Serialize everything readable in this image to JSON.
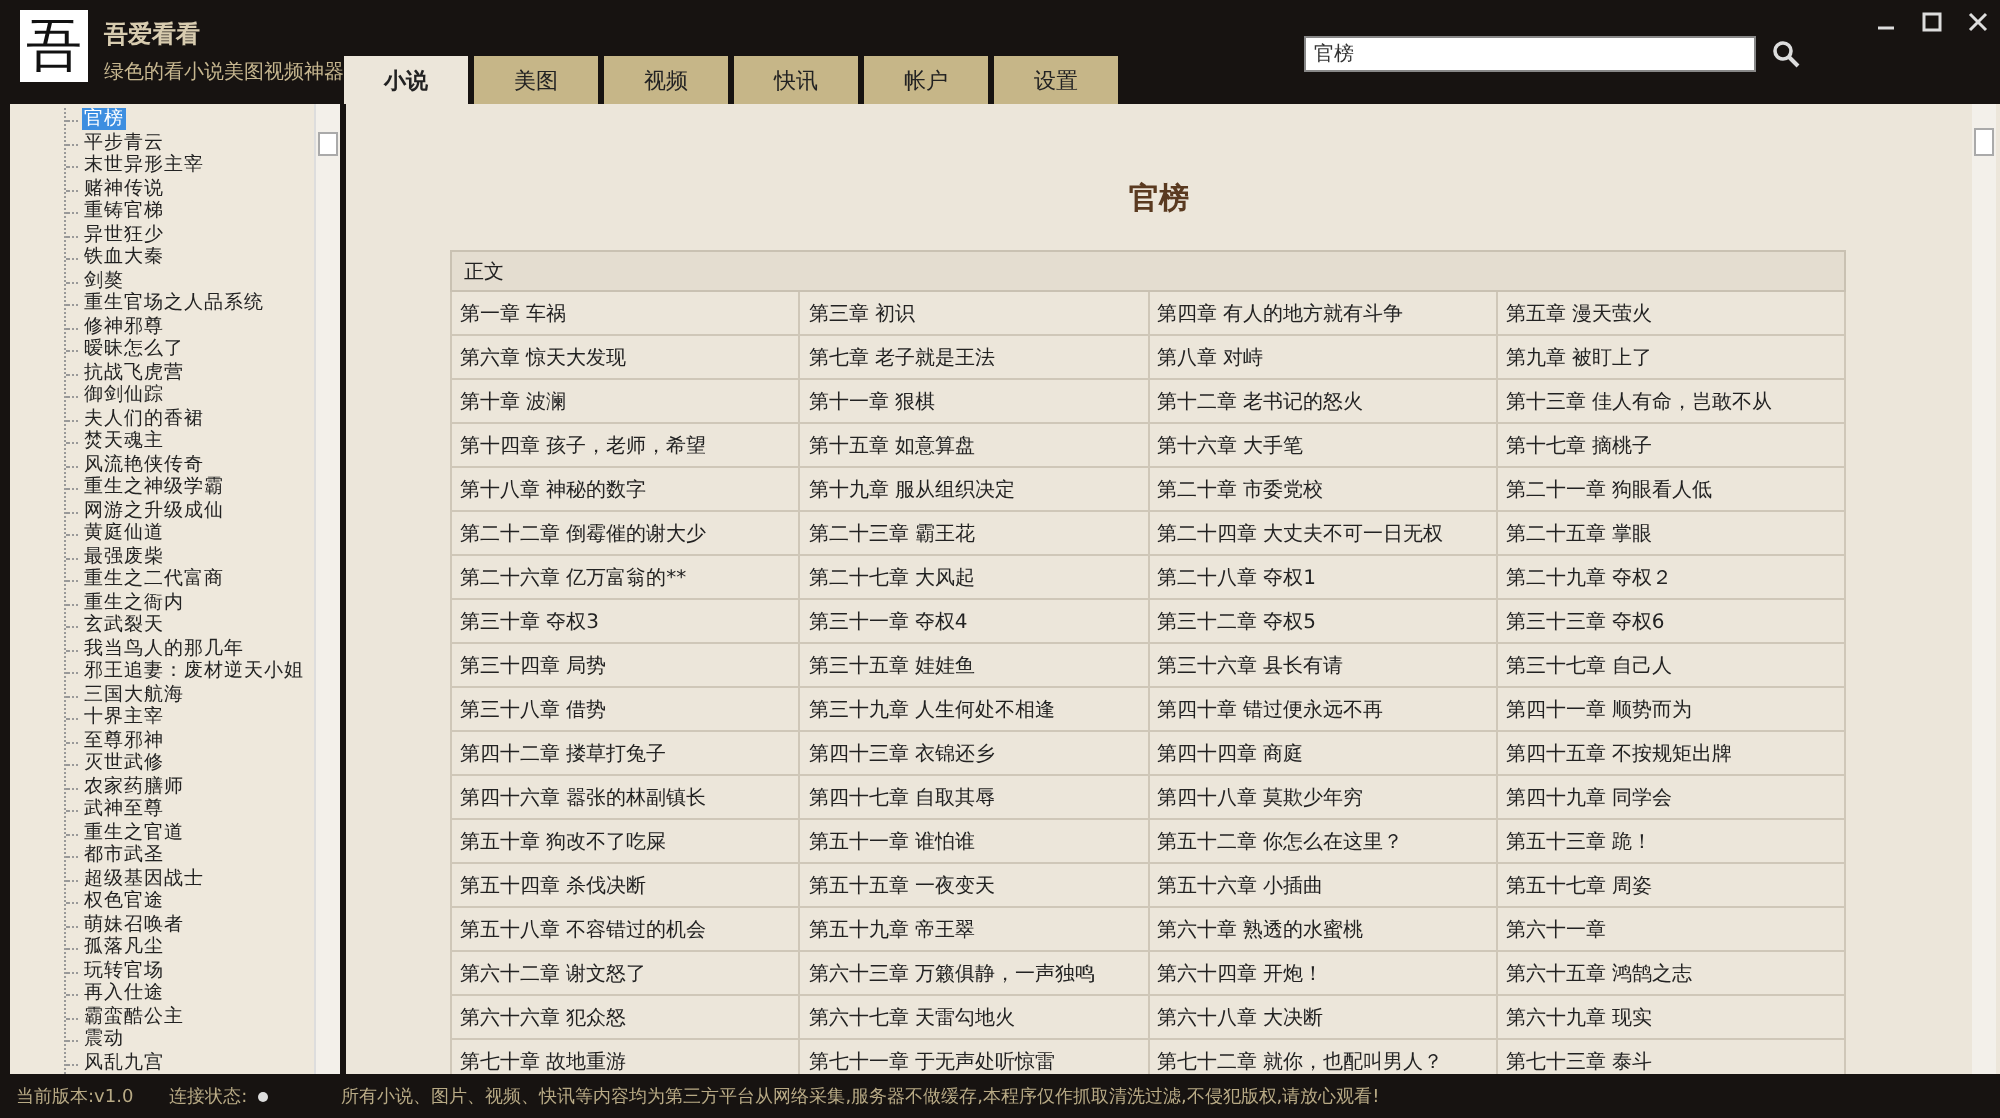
{
  "app": {
    "logo": "吾",
    "name": "吾爱看看",
    "tagline": "绿色的看小说美图视频神器"
  },
  "tabs": [
    {
      "label": "小说",
      "selected": true
    },
    {
      "label": "美图",
      "selected": false
    },
    {
      "label": "视频",
      "selected": false
    },
    {
      "label": "快讯",
      "selected": false
    },
    {
      "label": "帐户",
      "selected": false
    },
    {
      "label": "设置",
      "selected": false
    }
  ],
  "search": {
    "value": "官榜"
  },
  "sidebar": {
    "items": [
      {
        "label": "官榜",
        "selected": true
      },
      {
        "label": "平步青云",
        "selected": false
      },
      {
        "label": "末世异形主宰",
        "selected": false
      },
      {
        "label": "赌神传说",
        "selected": false
      },
      {
        "label": "重铸官梯",
        "selected": false
      },
      {
        "label": "异世狂少",
        "selected": false
      },
      {
        "label": "铁血大秦",
        "selected": false
      },
      {
        "label": "剑獒",
        "selected": false
      },
      {
        "label": "重生官场之人品系统",
        "selected": false
      },
      {
        "label": "修神邪尊",
        "selected": false
      },
      {
        "label": "暧昧怎么了",
        "selected": false
      },
      {
        "label": "抗战飞虎营",
        "selected": false
      },
      {
        "label": "御剑仙踪",
        "selected": false
      },
      {
        "label": "夫人们的香裙",
        "selected": false
      },
      {
        "label": "焚天魂主",
        "selected": false
      },
      {
        "label": "风流艳侠传奇",
        "selected": false
      },
      {
        "label": "重生之神级学霸",
        "selected": false
      },
      {
        "label": "网游之升级成仙",
        "selected": false
      },
      {
        "label": "黄庭仙道",
        "selected": false
      },
      {
        "label": "最强废柴",
        "selected": false
      },
      {
        "label": "重生之二代富商",
        "selected": false
      },
      {
        "label": "重生之衙内",
        "selected": false
      },
      {
        "label": "玄武裂天",
        "selected": false
      },
      {
        "label": "我当鸟人的那几年",
        "selected": false
      },
      {
        "label": "邪王追妻：废材逆天小姐",
        "selected": false
      },
      {
        "label": "三国大航海",
        "selected": false
      },
      {
        "label": "十界主宰",
        "selected": false
      },
      {
        "label": "至尊邪神",
        "selected": false
      },
      {
        "label": "灭世武修",
        "selected": false
      },
      {
        "label": "农家药膳师",
        "selected": false
      },
      {
        "label": "武神至尊",
        "selected": false
      },
      {
        "label": "重生之官道",
        "selected": false
      },
      {
        "label": "都市武圣",
        "selected": false
      },
      {
        "label": "超级基因战士",
        "selected": false
      },
      {
        "label": "权色官途",
        "selected": false
      },
      {
        "label": "萌妹召唤者",
        "selected": false
      },
      {
        "label": "孤落凡尘",
        "selected": false
      },
      {
        "label": "玩转官场",
        "selected": false
      },
      {
        "label": "再入仕途",
        "selected": false
      },
      {
        "label": "霸蛮酷公主",
        "selected": false
      },
      {
        "label": "震动",
        "selected": false
      },
      {
        "label": "风乱九宫",
        "selected": false
      }
    ]
  },
  "content": {
    "title": "官榜",
    "table": {
      "header": "正文",
      "rows": [
        [
          "第一章 车祸",
          "第三章 初识",
          "第四章 有人的地方就有斗争",
          "第五章 漫天萤火"
        ],
        [
          "第六章 惊天大发现",
          "第七章 老子就是王法",
          "第八章 对峙",
          "第九章 被盯上了"
        ],
        [
          "第十章 波澜",
          "第十一章 狠棋",
          "第十二章 老书记的怒火",
          "第十三章 佳人有命，岂敢不从"
        ],
        [
          "第十四章 孩子，老师，希望",
          "第十五章 如意算盘",
          "第十六章 大手笔",
          "第十七章 摘桃子"
        ],
        [
          "第十八章 神秘的数字",
          "第十九章 服从组织决定",
          "第二十章 市委党校",
          "第二十一章 狗眼看人低"
        ],
        [
          "第二十二章 倒霉催的谢大少",
          "第二十三章 霸王花",
          "第二十四章 大丈夫不可一日无权",
          "第二十五章 掌眼"
        ],
        [
          "第二十六章 亿万富翁的**",
          "第二十七章 大风起",
          "第二十八章 夺权1",
          "第二十九章 夺权２"
        ],
        [
          "第三十章 夺权3",
          "第三十一章 夺权4",
          "第三十二章 夺权5",
          "第三十三章 夺权6"
        ],
        [
          "第三十四章 局势",
          "第三十五章 娃娃鱼",
          "第三十六章 县长有请",
          "第三十七章 自己人"
        ],
        [
          "第三十八章 借势",
          "第三十九章 人生何处不相逢",
          "第四十章 错过便永远不再",
          "第四十一章 顺势而为"
        ],
        [
          "第四十二章 搂草打兔子",
          "第四十三章 衣锦还乡",
          "第四十四章 商庭",
          "第四十五章 不按规矩出牌"
        ],
        [
          "第四十六章 嚣张的林副镇长",
          "第四十七章 自取其辱",
          "第四十八章 莫欺少年穷",
          "第四十九章 同学会"
        ],
        [
          "第五十章 狗改不了吃屎",
          "第五十一章 谁怕谁",
          "第五十二章 你怎么在这里？",
          "第五十三章 跪！"
        ],
        [
          "第五十四章 杀伐决断",
          "第五十五章 一夜变天",
          "第五十六章 小插曲",
          "第五十七章 周姿"
        ],
        [
          "第五十八章 不容错过的机会",
          "第五十九章 帝王翠",
          "第六十章 熟透的水蜜桃",
          "第六十一章"
        ],
        [
          "第六十二章 谢文怒了",
          "第六十三章 万籁俱静，一声独鸣",
          "第六十四章 开炮！",
          "第六十五章 鸿鹄之志"
        ],
        [
          "第六十六章 犯众怒",
          "第六十七章 天雷勾地火",
          "第六十八章 大决断",
          "第六十九章 现实"
        ],
        [
          "第七十章 故地重游",
          "第七十一章 于无声处听惊雷",
          "第七十二章 就你，也配叫男人？",
          "第七十三章 泰斗"
        ]
      ]
    }
  },
  "status_bar": {
    "version": "当前版本:v1.0",
    "connection_label": "连接状态:",
    "notice": "所有小说、图片、视频、快讯等内容均为第三方平台从网络采集,服务器不做缓存,本程序仅作抓取清洗过滤,不侵犯版权,请放心观看!"
  }
}
